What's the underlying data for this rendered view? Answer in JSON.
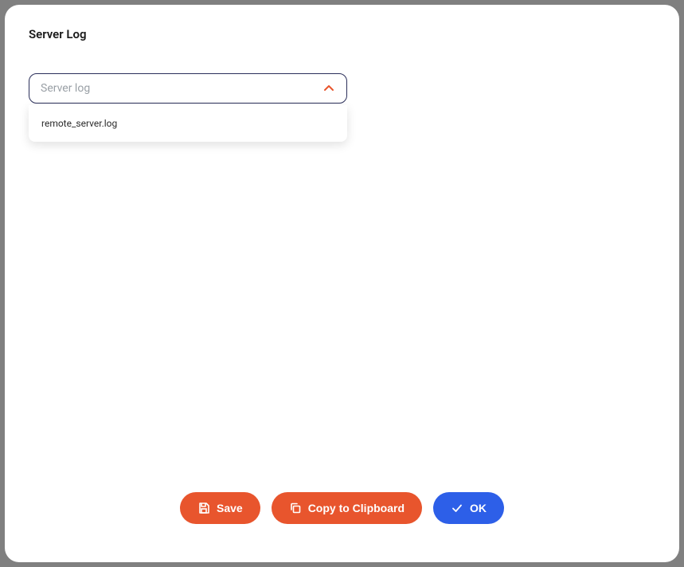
{
  "dialog": {
    "title": "Server Log"
  },
  "dropdown": {
    "placeholder": "Server log",
    "options": [
      {
        "label": "remote_server.log"
      }
    ]
  },
  "buttons": {
    "save": "Save",
    "copy": "Copy to Clipboard",
    "ok": "OK"
  },
  "colors": {
    "accent_orange": "#e8552d",
    "accent_blue": "#2d5fe8",
    "dropdown_border": "#2b2f5a"
  }
}
